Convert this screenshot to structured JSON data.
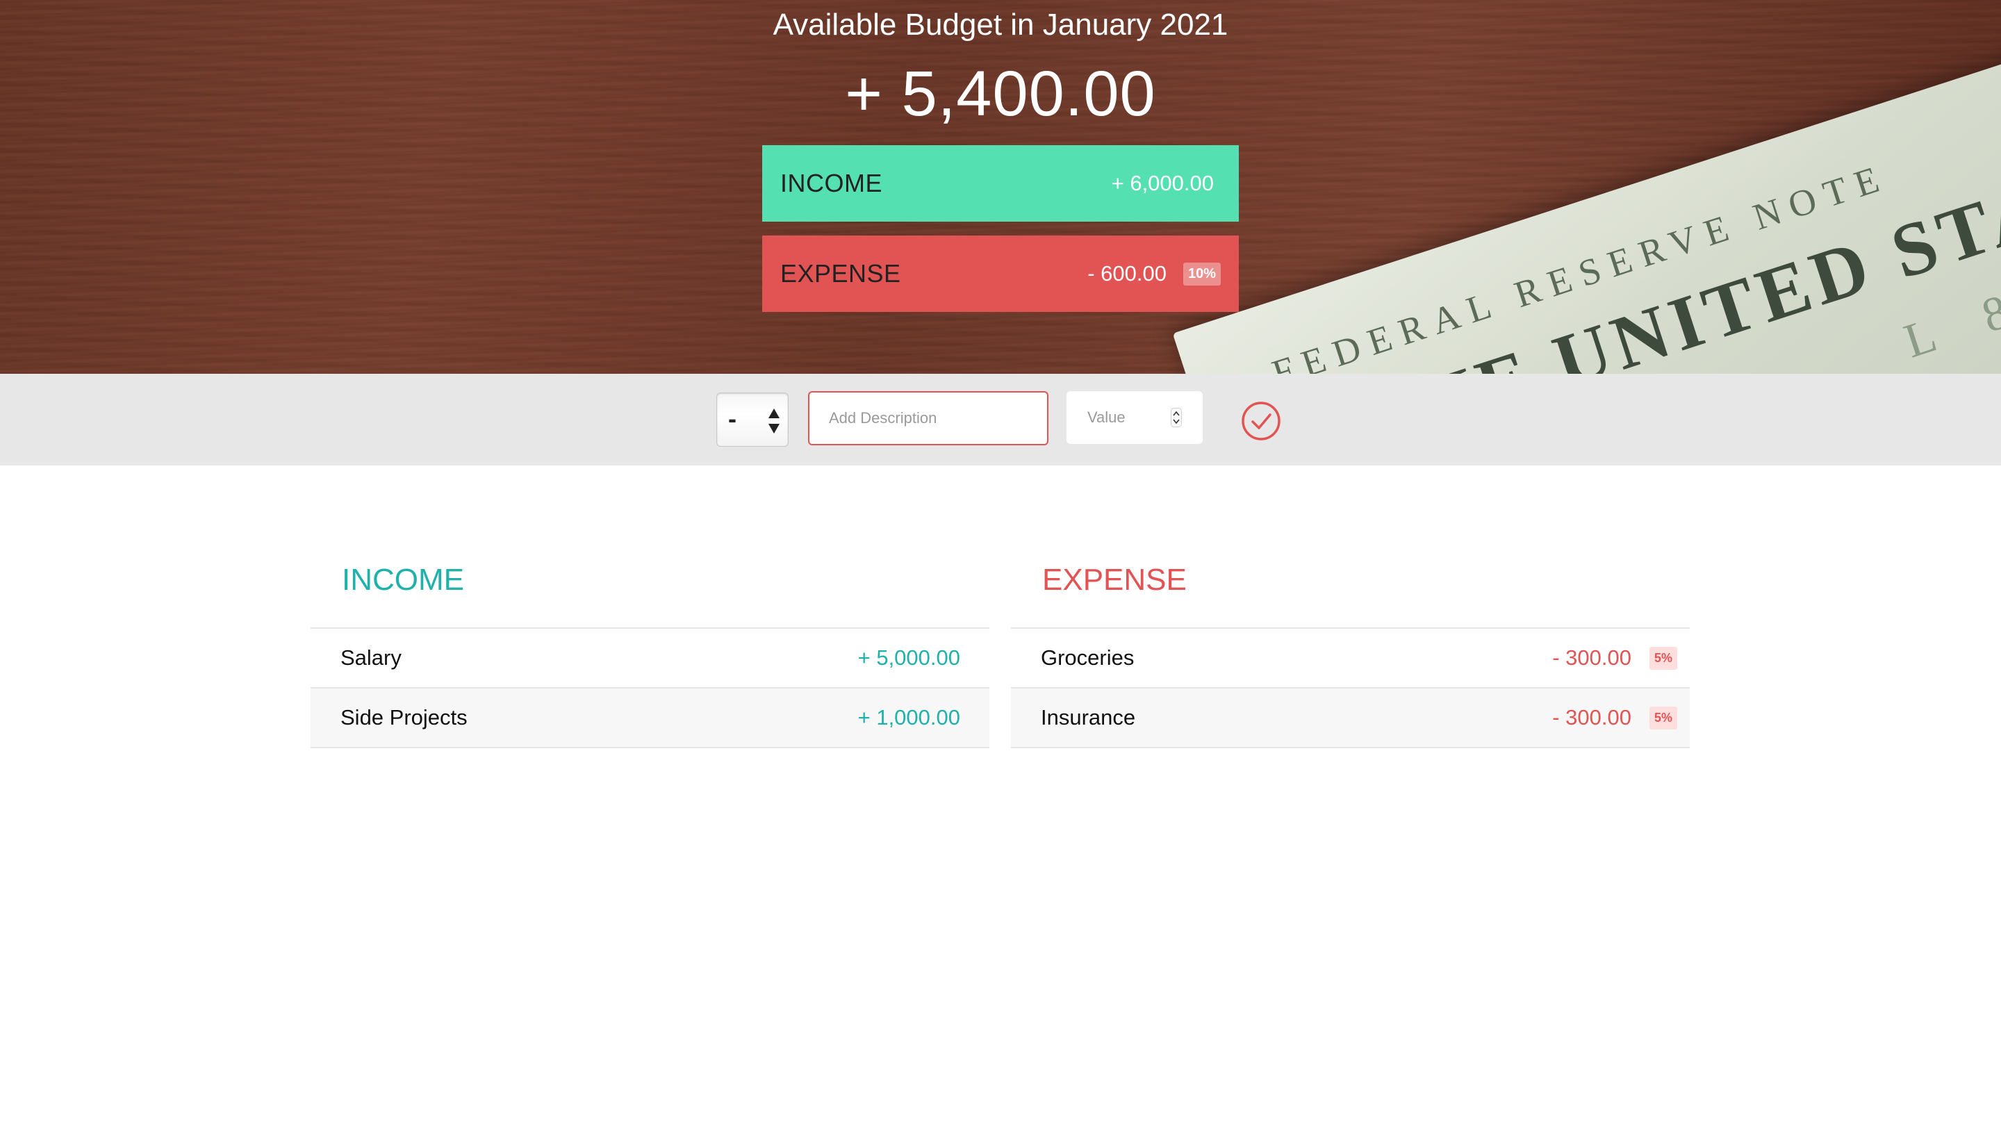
{
  "budget": {
    "title": "Available Budget in January 2021",
    "value": "+ 5,400.00"
  },
  "summary": {
    "income_label": "Income",
    "income_value": "+ 6,000.00",
    "expense_label": "Expense",
    "expense_value": "- 600.00",
    "expense_percentage": "10%"
  },
  "add_form": {
    "type_value": "-",
    "description_placeholder": "Add Description",
    "value_placeholder": "Value"
  },
  "income_list": {
    "title": "Income",
    "items": [
      {
        "description": "Salary",
        "value": "+ 5,000.00"
      },
      {
        "description": "Side Projects",
        "value": "+ 1,000.00"
      }
    ]
  },
  "expense_list": {
    "title": "Expense",
    "items": [
      {
        "description": "Groceries",
        "value": "- 300.00",
        "percentage": "5%"
      },
      {
        "description": "Insurance",
        "value": "- 300.00",
        "percentage": "5%"
      }
    ]
  },
  "colors": {
    "income_accent": "#55e0b1",
    "income_text": "#20b2aa",
    "expense_accent": "#e25454"
  },
  "icons": {
    "add_button": "check-circle-icon",
    "select_arrows": "up-down-arrows-icon",
    "value_spinner": "spinner-icon"
  }
}
